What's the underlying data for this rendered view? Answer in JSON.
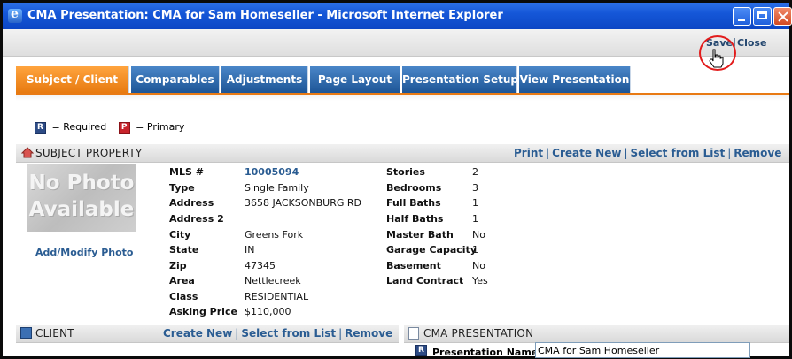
{
  "window": {
    "title": "CMA Presentation: CMA for Sam Homeseller - Microsoft Internet Explorer"
  },
  "toolbar": {
    "save_label": "Save",
    "separator": "|",
    "close_label": "Close"
  },
  "tabs": [
    {
      "label": "Subject / Client",
      "active": true
    },
    {
      "label": "Comparables",
      "active": false
    },
    {
      "label": "Adjustments",
      "active": false
    },
    {
      "label": "Page Layout",
      "active": false
    },
    {
      "label": "Presentation Setup",
      "active": false
    },
    {
      "label": "View Presentation",
      "active": false
    }
  ],
  "legend": {
    "required_glyph": "R",
    "required_label": "= Required",
    "primary_glyph": "P",
    "primary_label": "= Primary"
  },
  "subject": {
    "header": "SUBJECT PROPERTY",
    "links": {
      "print": "Print",
      "create_new": "Create New",
      "select_from_list": "Select from List",
      "remove": "Remove",
      "sep": "|"
    },
    "photo": {
      "line1": "No Photo",
      "line2": "Available",
      "add_link": "Add/Modify Photo"
    },
    "left_fields": [
      {
        "label": "MLS #",
        "value": "10005094"
      },
      {
        "label": "Type",
        "value": "Single Family"
      },
      {
        "label": "Address",
        "value": "3658 JACKSONBURG RD"
      },
      {
        "label": "Address 2",
        "value": ""
      },
      {
        "label": "City",
        "value": "Greens Fork"
      },
      {
        "label": "State",
        "value": "IN"
      },
      {
        "label": "Zip",
        "value": "47345"
      },
      {
        "label": "Area",
        "value": "Nettlecreek"
      },
      {
        "label": "Class",
        "value": "RESIDENTIAL"
      },
      {
        "label": "Asking Price",
        "value": "$110,000"
      }
    ],
    "right_fields": [
      {
        "label": "Stories",
        "value": "2"
      },
      {
        "label": "Bedrooms",
        "value": "3"
      },
      {
        "label": "Full Baths",
        "value": "1"
      },
      {
        "label": "Half Baths",
        "value": "1"
      },
      {
        "label": "Master Bath",
        "value": "No"
      },
      {
        "label": "Garage Capacity",
        "value": "1"
      },
      {
        "label": "Basement",
        "value": "No"
      },
      {
        "label": "Land Contract",
        "value": "Yes"
      }
    ]
  },
  "client": {
    "header": "CLIENT",
    "links": {
      "create_new": "Create New",
      "select_from_list": "Select from List",
      "remove": "Remove",
      "sep": "|"
    }
  },
  "cma": {
    "header": "CMA PRESENTATION",
    "name_label": "Presentation Name",
    "name_value": "CMA for Sam Homeseller"
  }
}
